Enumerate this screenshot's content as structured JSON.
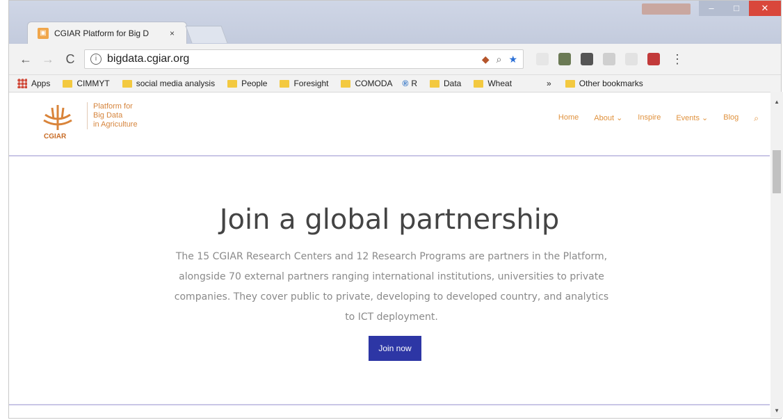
{
  "browser": {
    "tab_title": "CGIAR Platform for Big D",
    "tab_close": "×",
    "url": "bigdata.cgiar.org"
  },
  "bookmarks": [
    {
      "label": "Apps",
      "type": "apps"
    },
    {
      "label": "CIMMYT",
      "type": "folder"
    },
    {
      "label": "social media analysis",
      "type": "folder"
    },
    {
      "label": "People",
      "type": "folder"
    },
    {
      "label": "Foresight",
      "type": "folder"
    },
    {
      "label": "COMODA",
      "type": "folder"
    },
    {
      "label": "R",
      "type": "r"
    },
    {
      "label": "Data",
      "type": "folder"
    },
    {
      "label": "Wheat",
      "type": "folder"
    },
    {
      "label": "Other bookmarks",
      "type": "folder"
    }
  ],
  "site": {
    "logo_text": "CGIAR",
    "tagline": [
      "Platform for",
      "Big Data",
      "in Agriculture"
    ],
    "nav": [
      "Home",
      "About ⌄",
      "Inspire",
      "Events ⌄",
      "Blog"
    ]
  },
  "hero": {
    "title": "Join a global partnership",
    "text": "The 15 CGIAR Research Centers and 12 Research Programs are partners in the Platform, alongside 70 external partners ranging international institutions, universities to private companies. They cover public to private, developing to developed country, and analytics to ICT deployment.",
    "button": "Join now"
  },
  "colors": {
    "accent_orange": "#e0923e",
    "button_blue": "#2d36a5",
    "rule_lavender": "#c9c6e6"
  }
}
